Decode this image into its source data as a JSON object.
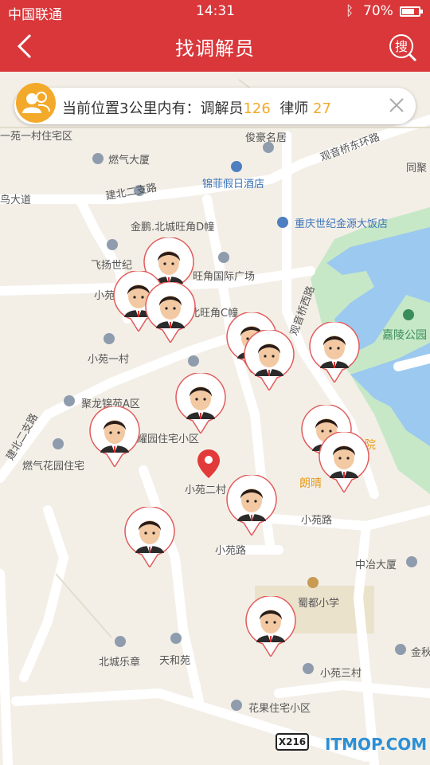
{
  "status_bar": {
    "carrier": "中国联通",
    "time": "14:31",
    "battery_pct": "70%",
    "battery_level": 0.7
  },
  "nav": {
    "title": "找调解员",
    "search_label": "搜"
  },
  "info_bar": {
    "prefix": "当前位置3公里内有：",
    "mediator_label": "调解员",
    "mediator_count": "126",
    "lawyer_label": "律师",
    "lawyer_count": "27"
  },
  "map_labels": {
    "xiaoyuan_yicun_zhaizhai": "一苑一村住宅区",
    "junhao_mingju": "俊豪名居",
    "guanyinqiao_donghuan": "观音桥东环路",
    "tongju": "同聚",
    "ranqi_dasha": "燃气大厦",
    "jinfei_hotel": "锦菲假日酒店",
    "jianbei_erzhi_lu": "建北二支路",
    "dadao": "鸟大道",
    "shijie_jinyuan_hotel": "重庆世纪金源大饭店",
    "jinpeng_beicheng": "金鹏.北城旺角D幢",
    "feiyang_shiji": "飞扬世纪",
    "wangjiao_guoji": "旺角国际广场",
    "xiaoyuan": "小苑",
    "wangjiao_c": "北旺角C幢",
    "guanyinqiao_xi": "观音桥西路",
    "jialing_park": "嘉陵公园",
    "xiaoyuan_yicun": "小苑一村",
    "julong_jinyuan_a": "聚龙锦苑A区",
    "yaoyuan_zhuzhai": "耀园住宅小区",
    "jianbei_erzhi_lu2": "建北二支路",
    "ranqi_huayuan": "燃气花园住宅",
    "yuan": "院",
    "langqing": "朗晴",
    "xiaoyuan_ercun": "小苑二村",
    "xiaoyuan_lu": "小苑路",
    "xiaoyuan_lu2": "小苑路",
    "zhongye_dasha": "中冶大厦",
    "shudu_xiaoxue": "蜀都小学",
    "beicheng_lezhang": "北城乐章",
    "tianheyuan": "天和苑",
    "jinqiu": "金秋",
    "xiaoyuan_sancun": "小苑三村",
    "huaguo_zhuzhai": "花果住宅小区",
    "road_badge": "X216"
  },
  "watermark": "ITMOP.COM"
}
